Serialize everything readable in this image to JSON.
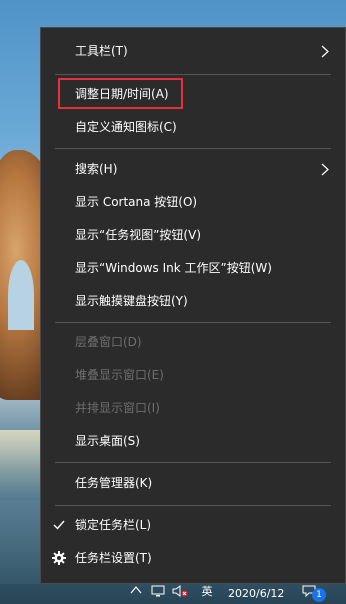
{
  "menu": {
    "items": [
      {
        "label": "工具栏(T)",
        "submenu": true,
        "enabled": true
      },
      {
        "label": "调整日期/时间(A)",
        "enabled": true,
        "highlighted": true
      },
      {
        "label": "自定义通知图标(C)",
        "enabled": true
      },
      {
        "label": "搜索(H)",
        "submenu": true,
        "enabled": true
      },
      {
        "label": "显示 Cortana 按钮(O)",
        "enabled": true
      },
      {
        "label": "显示“任务视图”按钮(V)",
        "enabled": true
      },
      {
        "label": "显示“Windows Ink 工作区”按钮(W)",
        "enabled": true
      },
      {
        "label": "显示触摸键盘按钮(Y)",
        "enabled": true
      },
      {
        "label": "层叠窗口(D)",
        "enabled": false
      },
      {
        "label": "堆叠显示窗口(E)",
        "enabled": false
      },
      {
        "label": "并排显示窗口(I)",
        "enabled": false
      },
      {
        "label": "显示桌面(S)",
        "enabled": true
      },
      {
        "label": "任务管理器(K)",
        "enabled": true
      },
      {
        "label": "锁定任务栏(L)",
        "enabled": true,
        "checked": true,
        "icon": "checkmark-icon"
      },
      {
        "label": "任务栏设置(T)",
        "enabled": true,
        "icon": "gear-icon"
      }
    ]
  },
  "taskbar": {
    "ime": "英",
    "date": "2020/6/12",
    "notification_count": "1"
  },
  "colors": {
    "menu_bg": "#2b2b2b",
    "text": "#ffffff",
    "disabled_text": "#6d6d6d",
    "highlight_border": "#e3303a"
  }
}
